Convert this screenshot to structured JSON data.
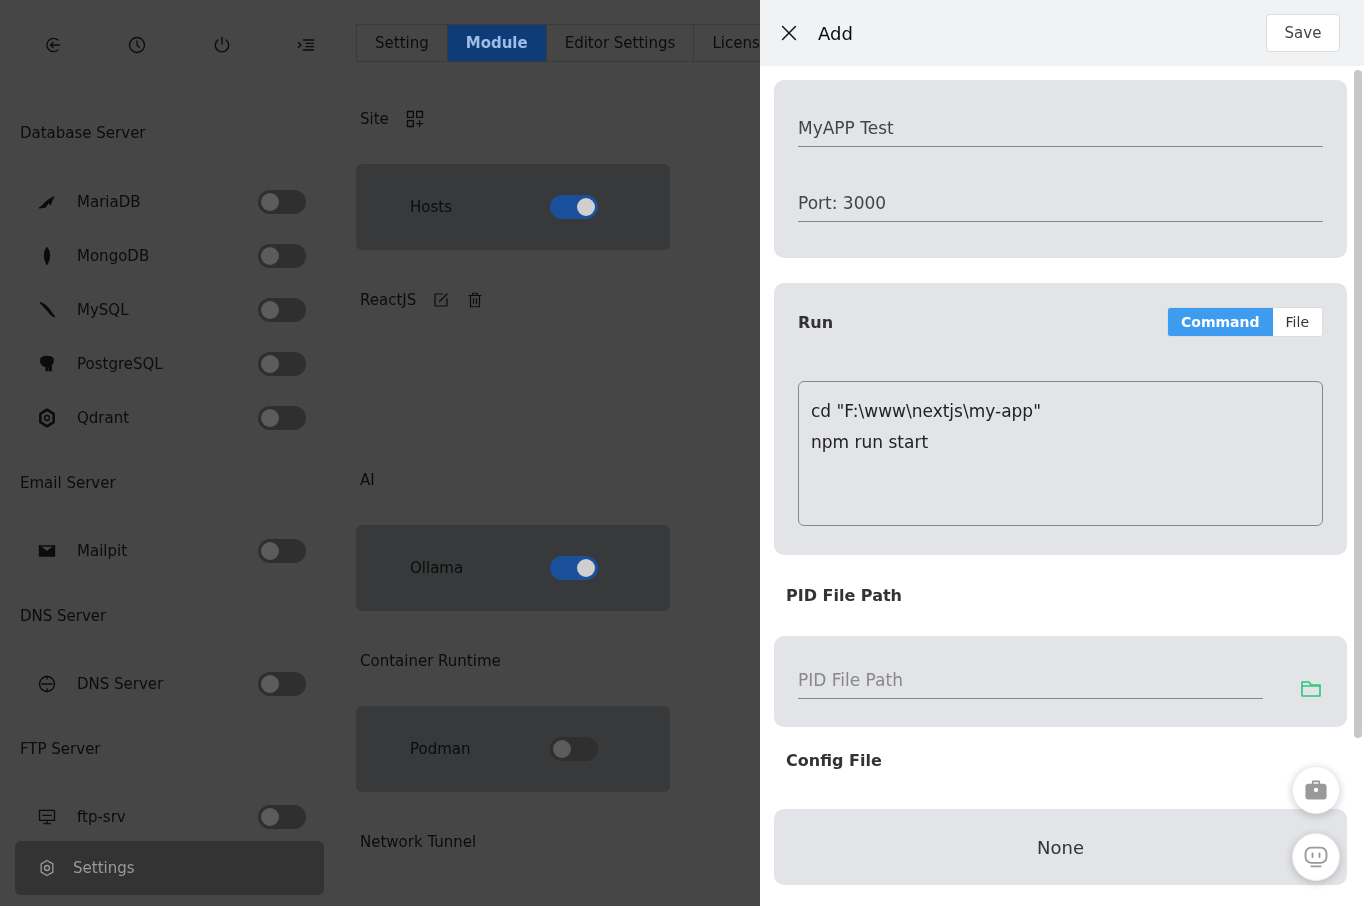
{
  "sidebar": {
    "sections": [
      {
        "title": "Database Server",
        "items": [
          {
            "label": "MariaDB",
            "on": false
          },
          {
            "label": "MongoDB",
            "on": false
          },
          {
            "label": "MySQL",
            "on": false
          },
          {
            "label": "PostgreSQL",
            "on": false
          },
          {
            "label": "Qdrant",
            "on": false
          }
        ]
      },
      {
        "title": "Email Server",
        "items": [
          {
            "label": "Mailpit",
            "on": false
          }
        ]
      },
      {
        "title": "DNS Server",
        "items": [
          {
            "label": "DNS Server",
            "on": false
          }
        ]
      },
      {
        "title": "FTP Server",
        "items": [
          {
            "label": "ftp-srv",
            "on": false
          }
        ]
      }
    ],
    "footer": {
      "label": "Settings",
      "selected": true
    }
  },
  "tabs": [
    {
      "label": "Setting",
      "selected": false
    },
    {
      "label": "Module",
      "selected": true
    },
    {
      "label": "Editor Settings",
      "selected": false
    },
    {
      "label": "Licens",
      "selected": false
    }
  ],
  "main": {
    "site": {
      "title": "Site",
      "cards": [
        {
          "label": "Hosts",
          "on": true
        }
      ],
      "sites": [
        {
          "label": "ReactJS"
        }
      ]
    },
    "groups": [
      {
        "title": "AI",
        "cards": [
          {
            "label": "Ollama",
            "on": true
          }
        ]
      },
      {
        "title": "Container Runtime",
        "cards": [
          {
            "label": "Podman",
            "on": false
          }
        ]
      },
      {
        "title": "Network Tunnel"
      }
    ]
  },
  "drawer": {
    "title": "Add",
    "save": "Save",
    "name": {
      "value": "MyAPP Test"
    },
    "port": {
      "value": "Port: 3000"
    },
    "run": {
      "label": "Run",
      "modes": [
        {
          "label": "Command",
          "selected": true
        },
        {
          "label": "File",
          "selected": false
        }
      ],
      "command": "cd \"F:\\www\\nextjs\\my-app\"\nnpm run start"
    },
    "pid": {
      "label": "PID File Path",
      "placeholder": "PID File Path"
    },
    "config": {
      "label": "Config File",
      "value": "None"
    }
  }
}
